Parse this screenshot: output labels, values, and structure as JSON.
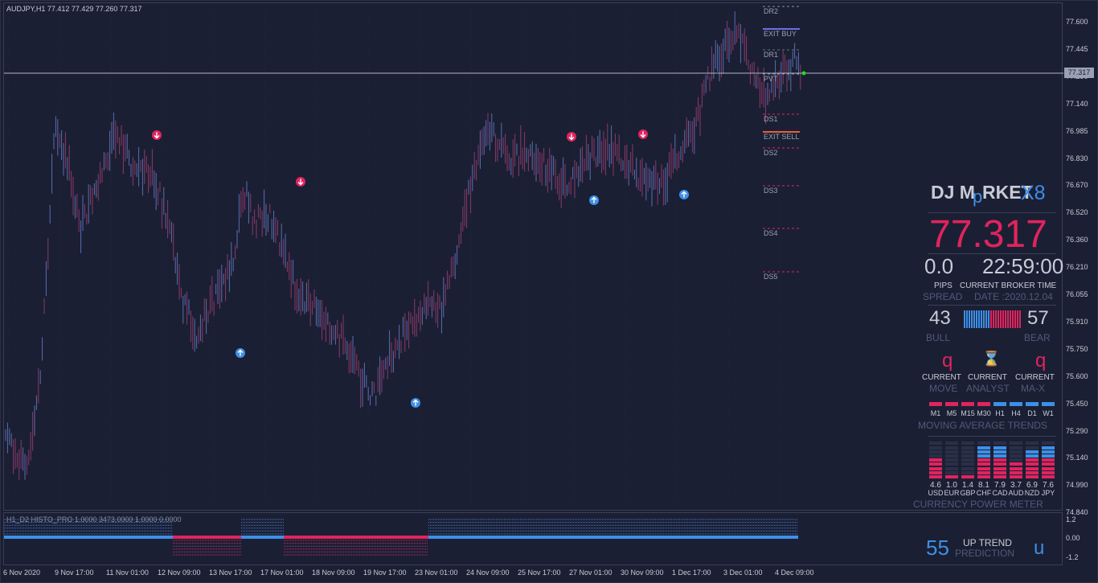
{
  "chart": {
    "title": "AUDJPY,H1  77.412 77.429 77.260 77.317",
    "current_price_label": "77.317",
    "y_axis_labels": [
      "77.600",
      "77.445",
      "77.290",
      "77.140",
      "76.985",
      "76.830",
      "76.670",
      "76.520",
      "76.360",
      "76.210",
      "76.055",
      "75.910",
      "75.750",
      "75.600",
      "75.450",
      "75.290",
      "75.140",
      "74.990",
      "74.840"
    ],
    "x_axis_labels": [
      "6 Nov 2020",
      "9 Nov 17:00",
      "11 Nov 01:00",
      "12 Nov 09:00",
      "13 Nov 17:00",
      "17 Nov 01:00",
      "18 Nov 09:00",
      "19 Nov 17:00",
      "23 Nov 01:00",
      "24 Nov 09:00",
      "25 Nov 17:00",
      "27 Nov 01:00",
      "30 Nov 09:00",
      "1 Dec 17:00",
      "3 Dec 01:00",
      "4 Dec 09:00"
    ],
    "pivot_labels": [
      "DR2",
      "EXIT BUY",
      "DR1",
      "PVT",
      "DS1",
      "EXIT SELL",
      "DS2",
      "DS3",
      "DS4",
      "DS5"
    ],
    "colors": {
      "bull": "#3d8fe8",
      "bear": "#e0245e",
      "price_line": "#b0b4c2",
      "exit_buy": "#6b6ee8",
      "exit_sell": "#e8603a"
    }
  },
  "subwindow": {
    "title": "H1_D2 HISTO_PRO  1.0000 3473.0000 1.0000 0.0000",
    "y_labels": [
      "1.2",
      "0.00",
      "-1.2"
    ],
    "prediction_value": "55",
    "trend_label": "UP TREND",
    "prediction_label": "PREDICTION",
    "arrow_glyph": "u"
  },
  "dashboard": {
    "brand_left": "DJ M",
    "brand_mid": "p",
    "brand_right": "RKET",
    "brand_suffix": "X8",
    "price": "77.317",
    "pips_value": "0.0",
    "time_value": "22:59:00",
    "pips_label": "PIPS",
    "time_label": "CURRENT BROKER TIME",
    "spread_label": "SPREAD",
    "date_label": "DATE :2020.12.04",
    "bull_value": "43",
    "bear_value": "57",
    "bull_label": "BULL",
    "bear_label": "BEAR",
    "move_glyph": "q",
    "analyst_glyph": "⌛",
    "max_glyph": "q",
    "current_label": "CURRENT",
    "move_label": "MOVE",
    "analyst_label": "ANALYST",
    "max_label": "MA-X",
    "timeframes": [
      "M1",
      "M5",
      "M15",
      "M30",
      "H1",
      "H4",
      "D1",
      "W1"
    ],
    "timeframe_trend": [
      "bear",
      "bear",
      "bear",
      "bear",
      "bull",
      "bull",
      "bull",
      "bull"
    ],
    "ma_label": "MOVING  AVERAGE  TRENDS",
    "currencies": [
      "USD",
      "EUR",
      "GBP",
      "CHF",
      "CAD",
      "AUD",
      "NZD",
      "JPY"
    ],
    "currency_values": [
      "4.6",
      "1.0",
      "1.4",
      "8.1",
      "7.9",
      "3.7",
      "6.9",
      "7.6"
    ],
    "currency_label": "CURRENCY  POWER  METER"
  }
}
